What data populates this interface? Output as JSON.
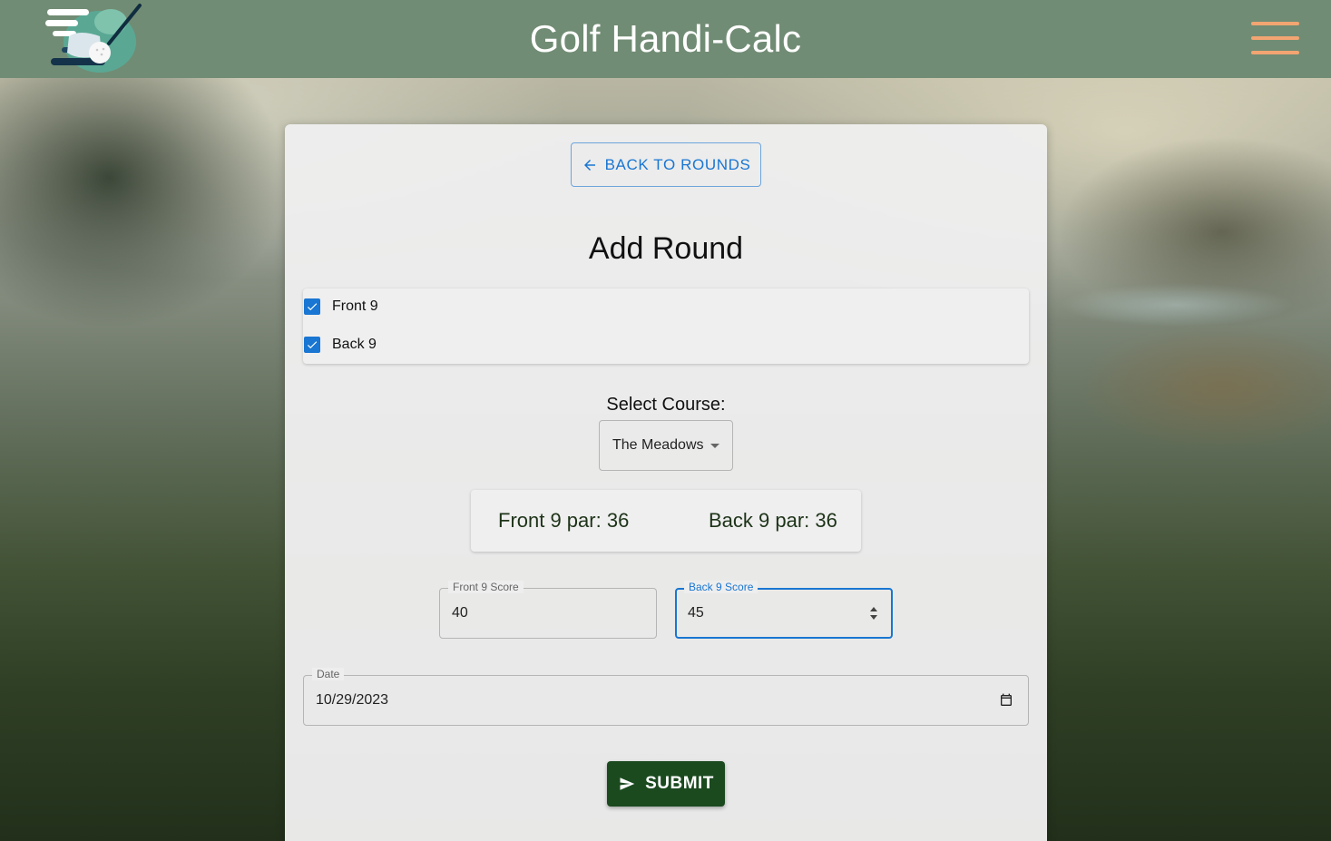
{
  "header": {
    "title": "Golf Handi-Calc",
    "logo_icon": "golf-club-ball-logo",
    "menu_icon": "hamburger-menu-icon",
    "accent_color": "#f2a572",
    "bar_color": "#718c74"
  },
  "form": {
    "back_button_label": "BACK TO ROUNDS",
    "title": "Add Round",
    "checkboxes": [
      {
        "label": "Front 9",
        "checked": true
      },
      {
        "label": "Back 9",
        "checked": true
      }
    ],
    "select_course_label": "Select Course:",
    "selected_course": "The Meadows",
    "par": {
      "front": "Front 9 par: 36",
      "back": "Back 9 par: 36"
    },
    "front_score": {
      "label": "Front 9 Score",
      "value": "40"
    },
    "back_score": {
      "label": "Back 9 Score",
      "value": "45"
    },
    "date": {
      "label": "Date",
      "value": "10/29/2023"
    },
    "submit_label": "SUBMIT",
    "primary_color": "#1976d2",
    "submit_color": "#1b4a1f"
  }
}
